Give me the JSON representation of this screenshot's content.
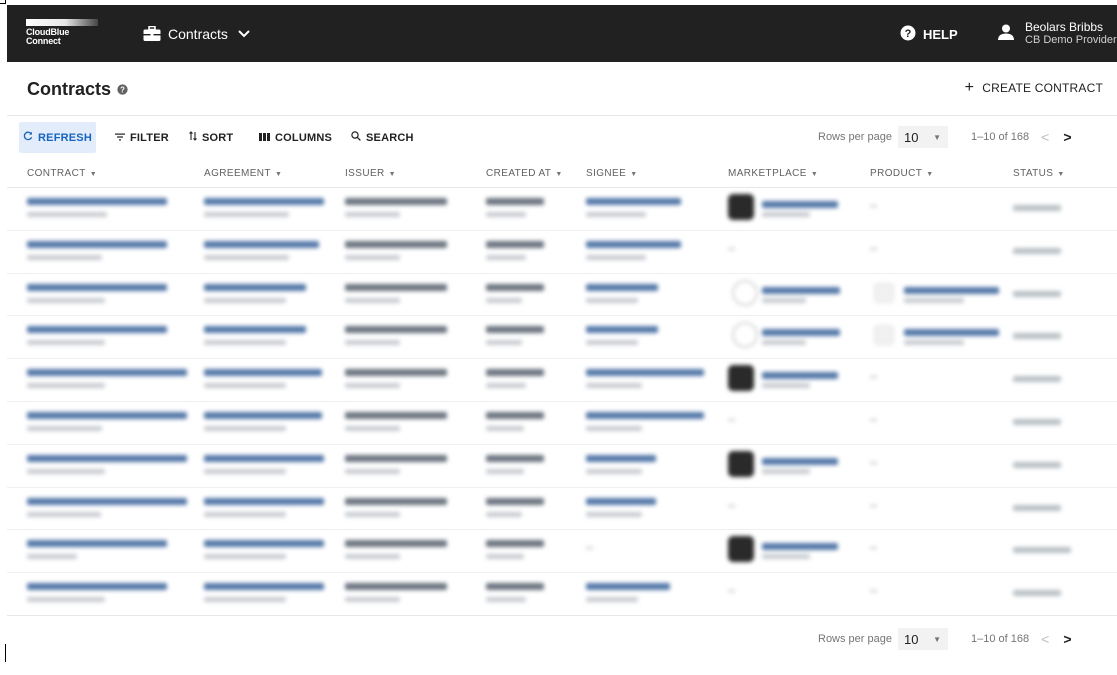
{
  "topbar": {
    "logo_line1": "CloudBlue",
    "logo_line2": "Connect",
    "module_label": "Contracts",
    "help_label": "HELP",
    "user_name": "Beolars Bribbs",
    "user_org": "CB Demo Provider"
  },
  "page": {
    "title": "Contracts",
    "create_label": "CREATE CONTRACT"
  },
  "toolbar": {
    "refresh_label": "REFRESH",
    "filter_label": "FILTER",
    "sort_label": "SORT",
    "columns_label": "COLUMNS",
    "search_label": "SEARCH"
  },
  "pagination": {
    "rows_per_page_label": "Rows per page",
    "rows_per_page_value": "10",
    "range_label": "1–10 of 168"
  },
  "table": {
    "columns": [
      "CONTRACT",
      "AGREEMENT",
      "ISSUER",
      "CREATED AT",
      "SIGNEE",
      "MARKETPLACE",
      "PRODUCT",
      "STATUS"
    ],
    "note": "Row contents are blurred/unreadable in the screenshot"
  },
  "icons": {
    "module": "briefcase-icon",
    "module_caret": "chevron-down-icon",
    "help": "help-circle-icon",
    "user": "person-icon",
    "title_info": "info-icon",
    "create": "plus-icon",
    "refresh": "refresh-icon",
    "filter": "filter-icon",
    "sort": "sort-icon",
    "columns": "columns-icon",
    "search": "search-icon",
    "prev": "chevron-left-icon",
    "next": "chevron-right-icon"
  },
  "colors": {
    "topbar_bg": "#212121",
    "accent": "#1565c0",
    "refresh_bg": "#e3ecfb"
  }
}
